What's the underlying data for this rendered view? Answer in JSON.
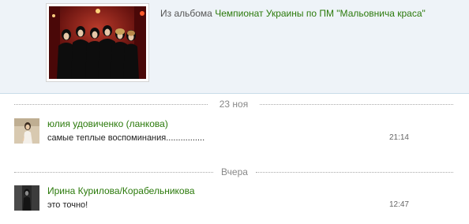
{
  "album": {
    "prefix": "Из альбома",
    "name": "Чемпионат Украины по ПМ \"Мальовнича краса\"",
    "link_color": "#2b7a0b"
  },
  "thread": [
    {
      "date": "23 ноя",
      "comment": {
        "author": "юлия удовиченко (ланкова)",
        "text": "самые теплые воспоминания................",
        "time": "21:14",
        "avatar_icon": "user-photo-avatar"
      }
    },
    {
      "date": "Вчера",
      "comment": {
        "author": "Ирина Курилова/Корабельникова",
        "text": "это точно!",
        "time": "12:47",
        "avatar_icon": "user-photo-avatar"
      }
    }
  ],
  "colors": {
    "panel_bg": "#eef3f8",
    "panel_border": "#c9dde9",
    "author": "#2b7a0b",
    "muted": "#888888"
  }
}
